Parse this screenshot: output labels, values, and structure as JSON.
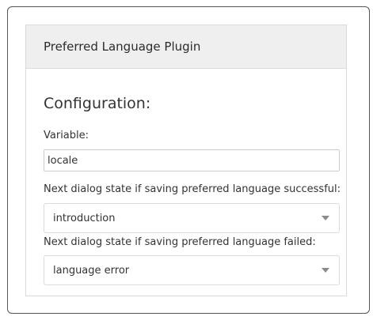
{
  "plugin": {
    "header_title": "Preferred Language Plugin",
    "section_title": "Configuration:",
    "variable": {
      "label": "Variable:",
      "value": "locale"
    },
    "success_state": {
      "label": "Next dialog state if saving preferred language successful:",
      "selected": "introduction"
    },
    "failure_state": {
      "label": "Next dialog state if saving preferred language failed:",
      "selected": "language error"
    }
  },
  "icons": {
    "dropdown": "chevron-down-icon"
  },
  "colors": {
    "header_bg": "#efefef",
    "panel_border": "#dadada",
    "frame_border": "#555555",
    "text": "#333333",
    "caret": "#8a8a8a"
  }
}
